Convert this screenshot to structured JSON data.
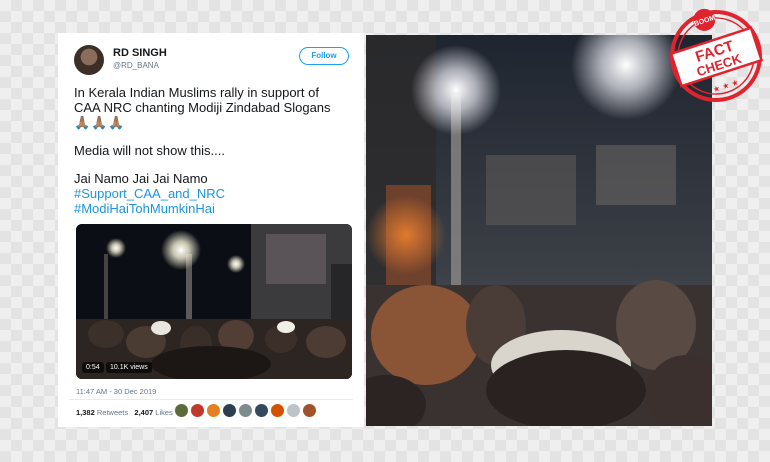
{
  "tweet": {
    "name": "RD SINGH",
    "handle": "@RD_BANA",
    "follow_label": "Follow",
    "line1": "In Kerala Indian Muslims rally in support of",
    "line2": "CAA NRC chanting Modiji Zindabad Slogans",
    "emojis": "🙏🏽🙏🏽🙏🏽",
    "line3": "Media will not show this....",
    "line4": "Jai Namo Jai Jai Namo",
    "hashtag1": "#Support_CAA_and_NRC",
    "hashtag2": "#ModiHaiTohMumkinHai",
    "video_duration": "0:54",
    "video_views": "10.1K views",
    "timestamp": "11:47 AM - 30 Dec 2019",
    "retweets_count": "1,382",
    "retweets_label": "Retweets",
    "likes_count": "2,407",
    "likes_label": "Likes"
  },
  "stamp": {
    "brand": "BOOM",
    "word1": "FACT",
    "word2": "CHECK"
  },
  "colors": {
    "link": "#1b95e0",
    "follow": "#1da1f2",
    "stamp_red": "#e0242f"
  }
}
